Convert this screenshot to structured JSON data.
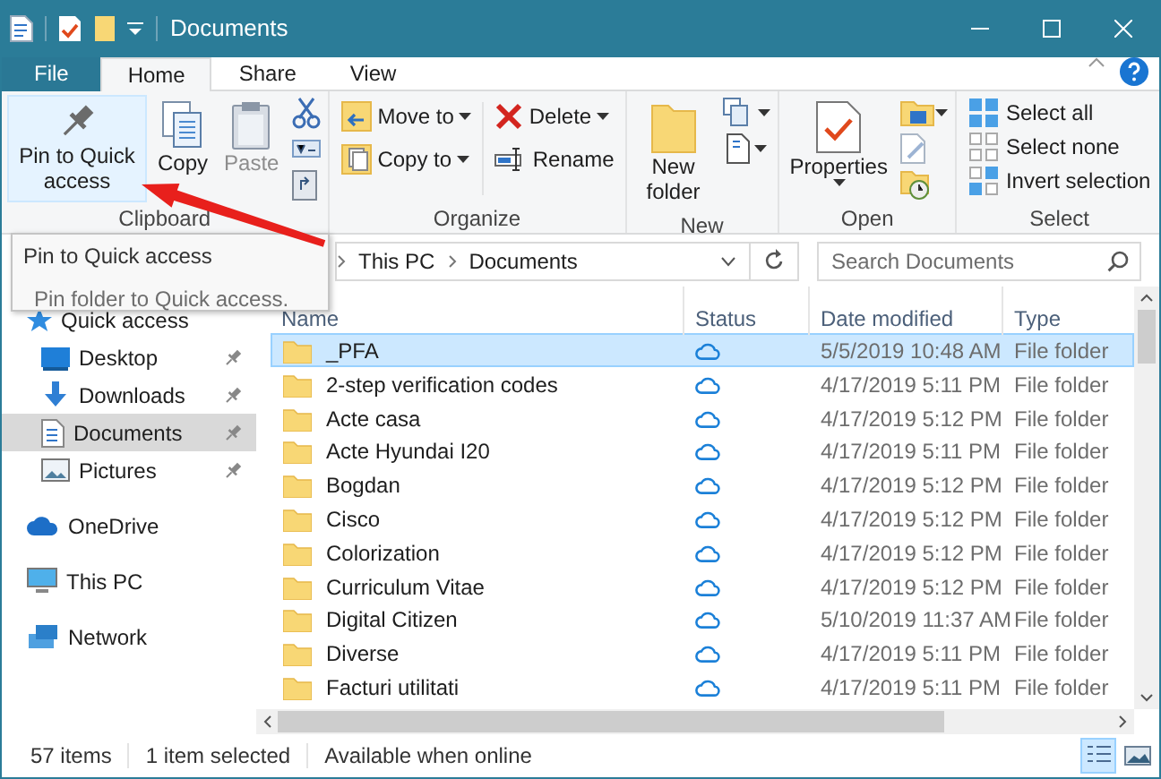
{
  "window": {
    "title": "Documents"
  },
  "ribbon_tabs": [
    {
      "label": "File",
      "kind": "file",
      "selected": false
    },
    {
      "label": "Home",
      "kind": "tab",
      "selected": true
    },
    {
      "label": "Share",
      "kind": "tab",
      "selected": false
    },
    {
      "label": "View",
      "kind": "tab",
      "selected": false
    }
  ],
  "ribbon": {
    "clipboard": {
      "label": "Clipboard",
      "pin": {
        "label": "Pin to Quick access",
        "hovered": true
      },
      "copy": {
        "label": "Copy"
      },
      "paste": {
        "label": "Paste",
        "disabled": true
      }
    },
    "organize": {
      "label": "Organize",
      "move_to": "Move to",
      "copy_to": "Copy to",
      "delete": "Delete",
      "rename": "Rename"
    },
    "new": {
      "label": "New",
      "new_folder": "New folder"
    },
    "open": {
      "label": "Open",
      "properties": "Properties"
    },
    "select": {
      "label": "Select",
      "select_all": "Select all",
      "select_none": "Select none",
      "invert_selection": "Invert selection"
    }
  },
  "tooltip": {
    "title": "Pin to Quick access",
    "text": "Pin folder to Quick access."
  },
  "address_bar": {
    "path": [
      "This PC",
      "Documents"
    ]
  },
  "search": {
    "placeholder": "Search Documents"
  },
  "navigation": [
    {
      "label": "Quick access",
      "kind": "quick",
      "selected": false,
      "children": [
        {
          "label": "Desktop",
          "kind": "desktop",
          "selected": false,
          "pinned": true
        },
        {
          "label": "Downloads",
          "kind": "downloads",
          "selected": false,
          "pinned": true
        },
        {
          "label": "Documents",
          "kind": "documents",
          "selected": true,
          "pinned": true
        },
        {
          "label": "Pictures",
          "kind": "pictures",
          "selected": false,
          "pinned": true
        }
      ]
    },
    {
      "label": "OneDrive",
      "kind": "onedrive",
      "selected": false
    },
    {
      "label": "This PC",
      "kind": "pc",
      "selected": false
    },
    {
      "label": "Network",
      "kind": "network",
      "selected": false
    }
  ],
  "table": {
    "columns": [
      "Name",
      "Status",
      "Date modified",
      "Type"
    ],
    "rows": [
      {
        "name": "_PFA",
        "date": "5/5/2019 10:48 AM",
        "type": "File folder",
        "selected": true
      },
      {
        "name": "2-step verification codes",
        "date": "4/17/2019 5:11 PM",
        "type": "File folder",
        "selected": false
      },
      {
        "name": "Acte casa",
        "date": "4/17/2019 5:12 PM",
        "type": "File folder",
        "selected": false
      },
      {
        "name": "Acte Hyundai I20",
        "date": "4/17/2019 5:11 PM",
        "type": "File folder",
        "selected": false
      },
      {
        "name": "Bogdan",
        "date": "4/17/2019 5:12 PM",
        "type": "File folder",
        "selected": false
      },
      {
        "name": "Cisco",
        "date": "4/17/2019 5:12 PM",
        "type": "File folder",
        "selected": false
      },
      {
        "name": "Colorization",
        "date": "4/17/2019 5:12 PM",
        "type": "File folder",
        "selected": false
      },
      {
        "name": "Curriculum Vitae",
        "date": "4/17/2019 5:12 PM",
        "type": "File folder",
        "selected": false
      },
      {
        "name": "Digital Citizen",
        "date": "5/10/2019 11:37 AM",
        "type": "File folder",
        "selected": false
      },
      {
        "name": "Diverse",
        "date": "4/17/2019 5:11 PM",
        "type": "File folder",
        "selected": false
      },
      {
        "name": "Facturi utilitati",
        "date": "4/17/2019 5:11 PM",
        "type": "File folder",
        "selected": false
      }
    ]
  },
  "status_bar": {
    "item_count": "57 items",
    "selection": "1 item selected",
    "availability": "Available when online"
  },
  "view_buttons": [
    {
      "kind": "details",
      "selected": true
    },
    {
      "kind": "thumbnails",
      "selected": false
    }
  ]
}
